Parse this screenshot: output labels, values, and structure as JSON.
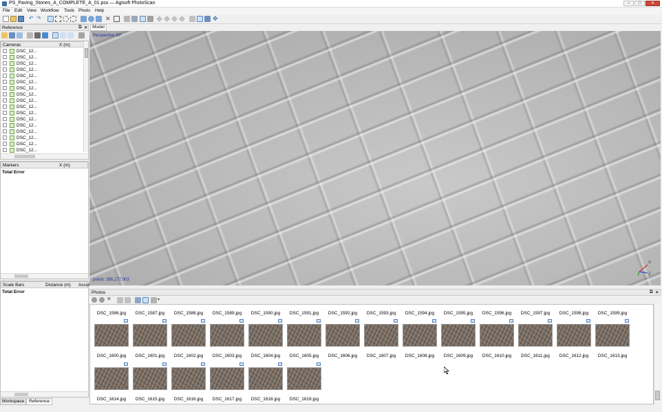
{
  "window": {
    "title": "PS_Paving_Stones_A_COMPLETE_A_01.psx — Agisoft PhotoScan",
    "controls": {
      "minimize": "–",
      "maximize": "□",
      "close": "✕"
    }
  },
  "menubar": [
    "File",
    "Edit",
    "View",
    "Workflow",
    "Tools",
    "Photo",
    "Help"
  ],
  "toolbar_icons": [
    "new-icon",
    "open-icon",
    "save-icon",
    "undo-icon",
    "redo-icon",
    "navigation-icon",
    "rectangle-select-icon",
    "circle-select-icon",
    "free-select-icon",
    "move-region-icon",
    "rotate-region-icon",
    "resize-region-icon",
    "rotate-object-icon",
    "delete-icon",
    "crop-icon",
    "grid-icon",
    "model-icon",
    "shaded-icon",
    "solid-icon",
    "wireframe-icon",
    "textured-icon",
    "tiled-icon",
    "orthomosaic-icon",
    "point-cloud-icon",
    "dense-cloud-icon",
    "show-cameras-icon",
    "show-markers-icon",
    "show-region-icon",
    "move-icon"
  ],
  "reference_pane": {
    "title": "Reference",
    "cameras_header": {
      "name": "Cameras",
      "x": "X (m)"
    },
    "cameras": [
      "DSC_12...",
      "DSC_12...",
      "DSC_12...",
      "DSC_12...",
      "DSC_12...",
      "DSC_12...",
      "DSC_12...",
      "DSC_12...",
      "DSC_12...",
      "DSC_12...",
      "DSC_12...",
      "DSC_12...",
      "DSC_12...",
      "DSC_12...",
      "DSC_12...",
      "DSC_12...",
      "DSC_12..."
    ],
    "markers_header": {
      "name": "Markers",
      "x": "X (m)"
    },
    "markers_total": "Total Error",
    "scalebars_header": {
      "name": "Scale Bars",
      "distance": "Distance (m)",
      "accuracy": "Accur"
    },
    "scalebars_total": "Total Error"
  },
  "bottom_tabs": {
    "workspace": "Workspace",
    "reference": "Reference"
  },
  "model_view": {
    "tab": "Model",
    "projection": "Perspective 30°",
    "points": "points: 395,177,003",
    "axes": {
      "x": "X",
      "y": "Y",
      "z": "Z"
    }
  },
  "photos_pane": {
    "title": "Photos",
    "row1_labels": [
      "DSC_1586.jpg",
      "DSC_1587.jpg",
      "DSC_1588.jpg",
      "DSC_1589.jpg",
      "DSC_1590.jpg",
      "DSC_1591.jpg",
      "DSC_1592.jpg",
      "DSC_1593.jpg",
      "DSC_1594.jpg",
      "DSC_1595.jpg",
      "DSC_1596.jpg",
      "DSC_1597.jpg",
      "DSC_1598.jpg",
      "DSC_1599.jpg"
    ],
    "row2_labels": [
      "DSC_1600.jpg",
      "DSC_1601.jpg",
      "DSC_1602.jpg",
      "DSC_1603.jpg",
      "DSC_1604.jpg",
      "DSC_1605.jpg",
      "DSC_1606.jpg",
      "DSC_1607.jpg",
      "DSC_1608.jpg",
      "DSC_1609.jpg",
      "DSC_1610.jpg",
      "DSC_1611.jpg",
      "DSC_1612.jpg",
      "DSC_1613.jpg"
    ],
    "row3_labels": [
      "DSC_1614.jpg",
      "DSC_1615.jpg",
      "DSC_1616.jpg",
      "DSC_1617.jpg",
      "DSC_1618.jpg",
      "DSC_1619.jpg"
    ]
  }
}
